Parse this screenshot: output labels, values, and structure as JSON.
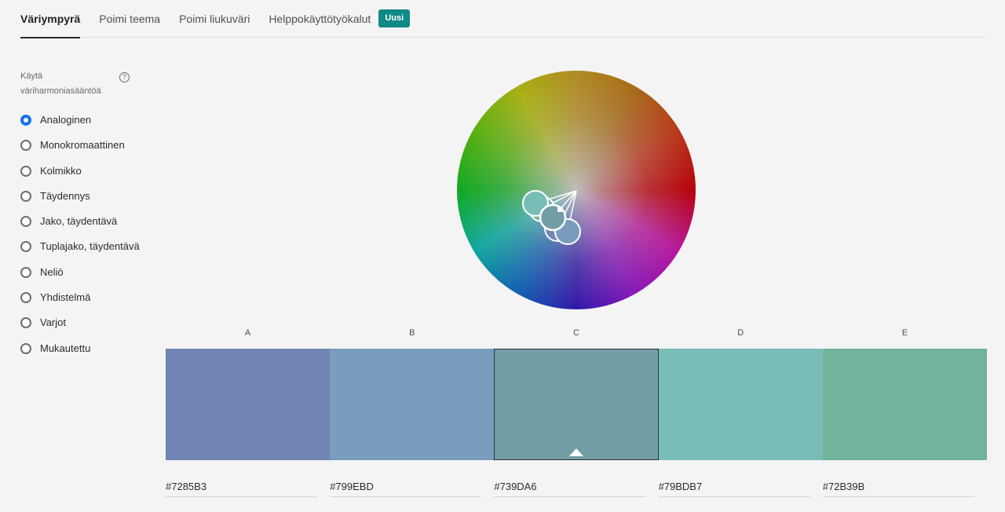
{
  "tabs": [
    {
      "label": "Väriympyrä",
      "active": true
    },
    {
      "label": "Poimi teema",
      "active": false
    },
    {
      "label": "Poimi liukuväri",
      "active": false
    },
    {
      "label": "Helppokäyttötyökalut",
      "active": false
    }
  ],
  "new_badge": "Uusi",
  "harmony": {
    "title": "Käytä väriharmoniasääntöä",
    "help_icon": "?",
    "options": [
      {
        "label": "Analoginen",
        "checked": true
      },
      {
        "label": "Monokromaattinen",
        "checked": false
      },
      {
        "label": "Kolmikko",
        "checked": false
      },
      {
        "label": "Täydennys",
        "checked": false
      },
      {
        "label": "Jako, täydentävä",
        "checked": false
      },
      {
        "label": "Tuplajako, täydentävä",
        "checked": false
      },
      {
        "label": "Neliö",
        "checked": false
      },
      {
        "label": "Yhdistelmä",
        "checked": false
      },
      {
        "label": "Varjot",
        "checked": false
      },
      {
        "label": "Mukautettu",
        "checked": false
      }
    ]
  },
  "swatches": [
    {
      "letter": "A",
      "hex": "#7285B3",
      "color": "#7285B3",
      "selected": false
    },
    {
      "letter": "B",
      "hex": "#799EBD",
      "color": "#799EBD",
      "selected": false
    },
    {
      "letter": "C",
      "hex": "#739DA6",
      "color": "#739DA6",
      "selected": true
    },
    {
      "letter": "D",
      "hex": "#79BDB7",
      "color": "#79BDB7",
      "selected": false
    },
    {
      "letter": "E",
      "hex": "#72B39B",
      "color": "#72B39B",
      "selected": false
    }
  ],
  "accent_color": "#1473e6"
}
